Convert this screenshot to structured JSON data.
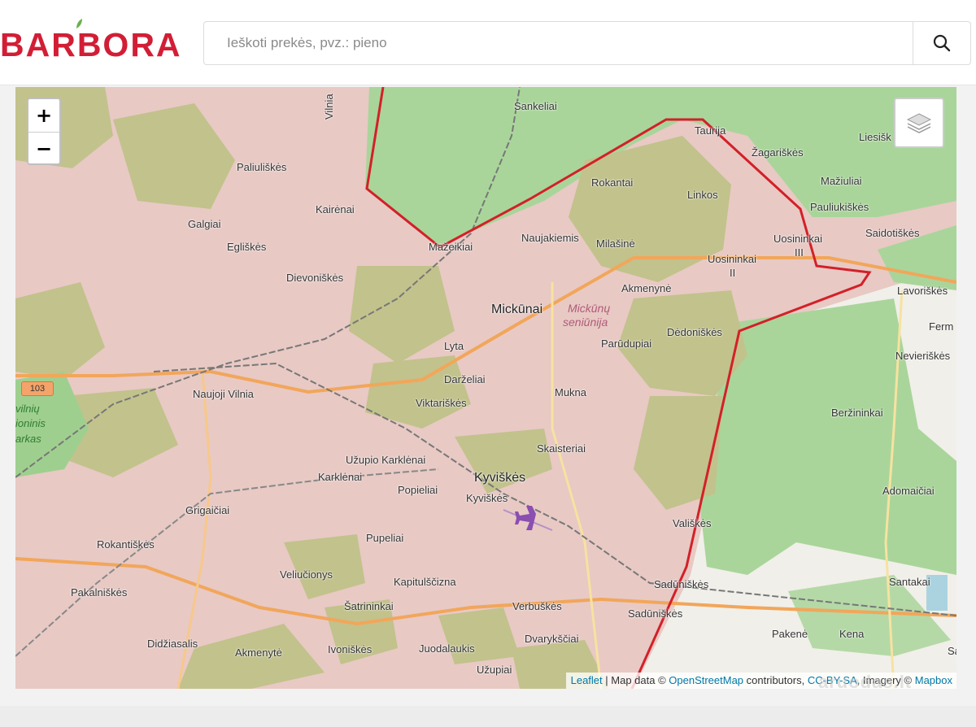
{
  "header": {
    "logo_text": "BARBORA",
    "search_placeholder": "Ieškoti prekės, pvz.: pieno",
    "search_button_icon": "search-icon"
  },
  "colors": {
    "brand": "#d21e35",
    "forest": "#a9d59a",
    "urban": "#e8c9c4",
    "boundary": "#d32029",
    "road": "#f2a65a"
  },
  "map": {
    "zoom_in_label": "+",
    "zoom_out_label": "−",
    "layers_icon": "layers-icon",
    "road_badge": "103",
    "places": [
      {
        "name": "Sankeliai",
        "kind": "village"
      },
      {
        "name": "Taurija",
        "kind": "village"
      },
      {
        "name": "Žagariškės",
        "kind": "village"
      },
      {
        "name": "Liesišk",
        "kind": "village"
      },
      {
        "name": "Mažiuliai",
        "kind": "village"
      },
      {
        "name": "Pauliukiškės",
        "kind": "village"
      },
      {
        "name": "Saidotiškės",
        "kind": "village"
      },
      {
        "name": "Rokantai",
        "kind": "village"
      },
      {
        "name": "Linkos",
        "kind": "village"
      },
      {
        "name": "Uosininkai",
        "kind": "village"
      },
      {
        "name": "III",
        "kind": "village"
      },
      {
        "name": "Uosininkai",
        "kind": "village"
      },
      {
        "name": "II",
        "kind": "village"
      },
      {
        "name": "Lavoriškės",
        "kind": "village"
      },
      {
        "name": "Paliuliškės",
        "kind": "village"
      },
      {
        "name": "Kairėnai",
        "kind": "village"
      },
      {
        "name": "Galgiai",
        "kind": "village"
      },
      {
        "name": "Egliškės",
        "kind": "village"
      },
      {
        "name": "Naujakiemis",
        "kind": "village"
      },
      {
        "name": "Milašinė",
        "kind": "village"
      },
      {
        "name": "Mažeikiai",
        "kind": "village"
      },
      {
        "name": "Dievoniškės",
        "kind": "village"
      },
      {
        "name": "Akmenynė",
        "kind": "village"
      },
      {
        "name": "Mickūnai",
        "kind": "town"
      },
      {
        "name": "Mickūnų",
        "kind": "area"
      },
      {
        "name": "seniūnija",
        "kind": "area"
      },
      {
        "name": "Ferm",
        "kind": "village"
      },
      {
        "name": "Dėdoniškės",
        "kind": "village"
      },
      {
        "name": "Parūdupiai",
        "kind": "village"
      },
      {
        "name": "Lyta",
        "kind": "village"
      },
      {
        "name": "Nevieriškės",
        "kind": "village"
      },
      {
        "name": "Naujoji Vilnia",
        "kind": "village"
      },
      {
        "name": "Darželiai",
        "kind": "village"
      },
      {
        "name": "Viktariškės",
        "kind": "village"
      },
      {
        "name": "Mukna",
        "kind": "village"
      },
      {
        "name": "Beržininkai",
        "kind": "village"
      },
      {
        "name": "Skaisteriai",
        "kind": "village"
      },
      {
        "name": "Užupio Karklėnai",
        "kind": "village"
      },
      {
        "name": "Karklėnai",
        "kind": "village"
      },
      {
        "name": "Kyviškės",
        "kind": "town"
      },
      {
        "name": "Popieliai",
        "kind": "village"
      },
      {
        "name": "Kyviškės",
        "kind": "village"
      },
      {
        "name": "Adomaičiai",
        "kind": "village"
      },
      {
        "name": "Grigaičiai",
        "kind": "village"
      },
      {
        "name": "Vališkės",
        "kind": "village"
      },
      {
        "name": "Rokantiškės",
        "kind": "village"
      },
      {
        "name": "Pupeliai",
        "kind": "village"
      },
      {
        "name": "Veliučionys",
        "kind": "village"
      },
      {
        "name": "Pakalniškės",
        "kind": "village"
      },
      {
        "name": "Kapitulščizna",
        "kind": "village"
      },
      {
        "name": "Sadūniškės",
        "kind": "village"
      },
      {
        "name": "Santakai",
        "kind": "village"
      },
      {
        "name": "Šatrininkai",
        "kind": "village"
      },
      {
        "name": "Verbuškės",
        "kind": "village"
      },
      {
        "name": "Sadūniškės",
        "kind": "village"
      },
      {
        "name": "Didžiasalis",
        "kind": "village"
      },
      {
        "name": "Dvarykščiai",
        "kind": "village"
      },
      {
        "name": "Pakenė",
        "kind": "village"
      },
      {
        "name": "Kena",
        "kind": "village"
      },
      {
        "name": "Akmenytė",
        "kind": "village"
      },
      {
        "name": "Ivoniškės",
        "kind": "village"
      },
      {
        "name": "Juodalaukis",
        "kind": "village"
      },
      {
        "name": "Užupiai",
        "kind": "village"
      },
      {
        "name": "vilnių",
        "kind": "park"
      },
      {
        "name": "ioninis",
        "kind": "park"
      },
      {
        "name": "arkas",
        "kind": "park"
      },
      {
        "name": "Vilnia",
        "kind": "village"
      },
      {
        "name": "Sa",
        "kind": "village"
      }
    ],
    "attribution": {
      "leaflet": "Leaflet",
      "sep": " | Map data © ",
      "osm": "OpenStreetMap",
      "contrib": " contributors, ",
      "license": "CC-BY-SA",
      "imagery": ", Imagery © ",
      "mapbox": "Mapbox"
    },
    "watermark": "aruodas.lt"
  }
}
